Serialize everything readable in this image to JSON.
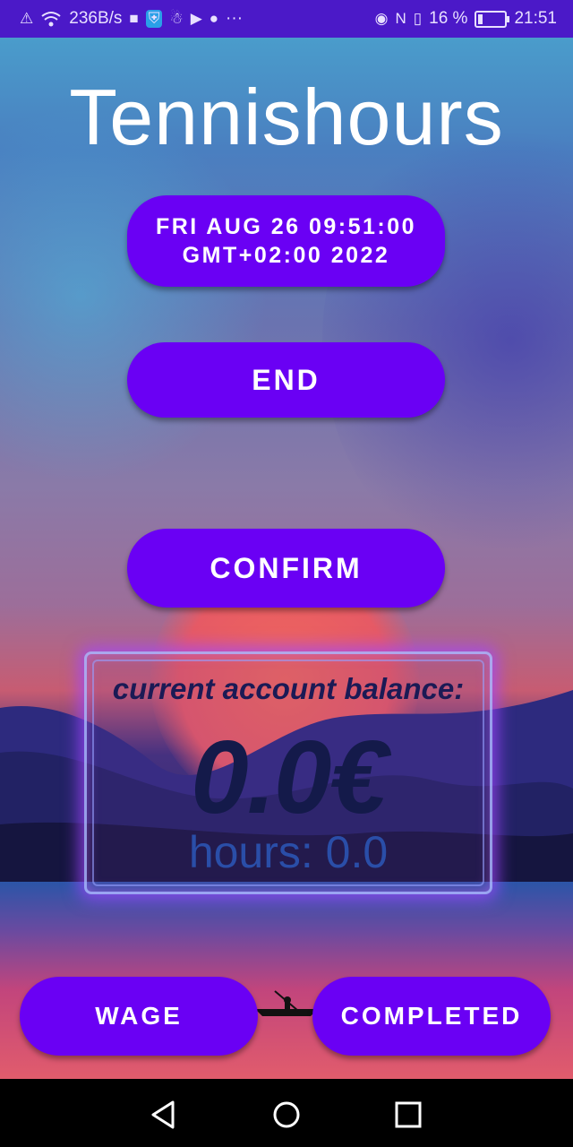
{
  "status_bar": {
    "net_speed": "236B/s",
    "more": "···",
    "battery_percent": "16 %",
    "battery_level": 0.16,
    "time": "21:51",
    "icons": [
      "alert-icon",
      "wifi-icon",
      "square-icon",
      "shield-app-icon",
      "gamepad-icon",
      "play-icon",
      "keyhole-icon",
      "eye-icon",
      "nfc-icon",
      "vibrate-icon",
      "battery-icon"
    ]
  },
  "app": {
    "title": "Tennishours",
    "date_button": "FRI AUG 26 09:51:00 GMT+02:00 2022",
    "end_button": "END",
    "confirm_button": "CONFIRM",
    "balance": {
      "label": "current account balance:",
      "value": "0.0€",
      "hours": "hours: 0.0"
    },
    "wage_button": "WAGE",
    "completed_button": "COMPLETED"
  },
  "navigation": {
    "back": "back-icon",
    "home": "home-icon",
    "recents": "recents-icon"
  },
  "colors": {
    "accent": "#6a00f4",
    "status_bar": "#4b19c8"
  }
}
